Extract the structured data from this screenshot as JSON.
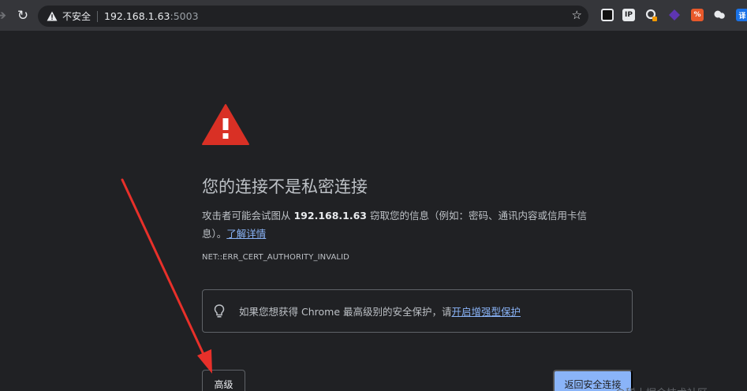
{
  "toolbar": {
    "reload_icon": "reload-icon",
    "security_label": "不安全",
    "url_host": "192.168.1.63",
    "url_port": ":5003",
    "bookmark_icon": "star-icon",
    "extensions": [
      {
        "name": "extension-dark-icon",
        "color": "#000000",
        "label": ""
      },
      {
        "name": "extension-ip-icon",
        "color": "#e8eaed",
        "label": "IP"
      },
      {
        "name": "extension-search-icon",
        "color": "#e8eaed",
        "label": ""
      },
      {
        "name": "extension-purple-icon",
        "color": "#5e35b1",
        "label": ""
      },
      {
        "name": "extension-orange-icon",
        "color": "#e8592b",
        "label": "%"
      },
      {
        "name": "extension-chat-icon",
        "color": "#e8eaed",
        "label": ""
      },
      {
        "name": "extension-translate-icon",
        "color": "#1a73e8",
        "label": "译"
      }
    ]
  },
  "interstitial": {
    "heading": "您的连接不是私密连接",
    "body_prefix": "攻击者可能会试图从 ",
    "host": "192.168.1.63",
    "body_line1_suffix": " 窃取您的信息（例如：密码、通讯内容或信用卡信",
    "body_line2": "息）。",
    "learn_more": "了解详情",
    "error_code": "NET::ERR_CERT_AUTHORITY_INVALID",
    "promo_text": "如果您想获得 Chrome 最高级别的安全保护，请",
    "promo_link": "开启增强型保护",
    "advanced_button": "高级",
    "back_button": "返回安全连接"
  },
  "watermark": "@稀土掘金技术社区",
  "colors": {
    "background": "#202124",
    "warning_red": "#d93025",
    "link": "#8ab4f8",
    "primary_button": "#8ab4f8",
    "annotation_arrow": "#e8302a"
  }
}
